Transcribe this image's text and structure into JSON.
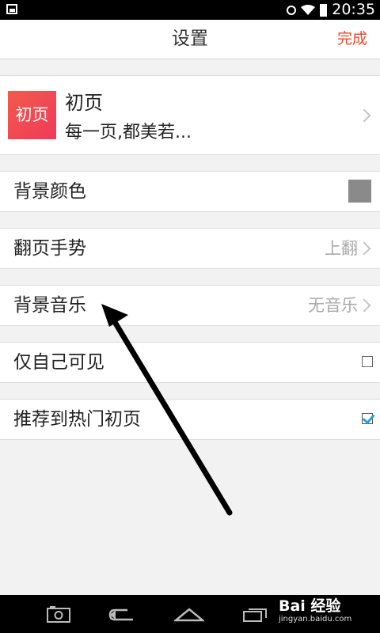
{
  "statusbar": {
    "time": "20:35"
  },
  "header": {
    "title": "设置",
    "done_label": "完成"
  },
  "profile": {
    "thumb_text": "初页",
    "name": "初页",
    "description": "每一页,都美若..."
  },
  "settings": {
    "background_color": {
      "label": "背景颜色",
      "swatch_color": "#8a8a8a"
    },
    "page_gesture": {
      "label": "翻页手势",
      "value": "上翻"
    },
    "background_music": {
      "label": "背景音乐",
      "value": "无音乐"
    },
    "only_self_visible": {
      "label": "仅自己可见",
      "checked": false
    },
    "recommend_hot": {
      "label": "推荐到热门初页",
      "checked": true
    }
  },
  "watermark": {
    "brand": "Bai 经验",
    "site": "jingyan.baidu.com"
  }
}
